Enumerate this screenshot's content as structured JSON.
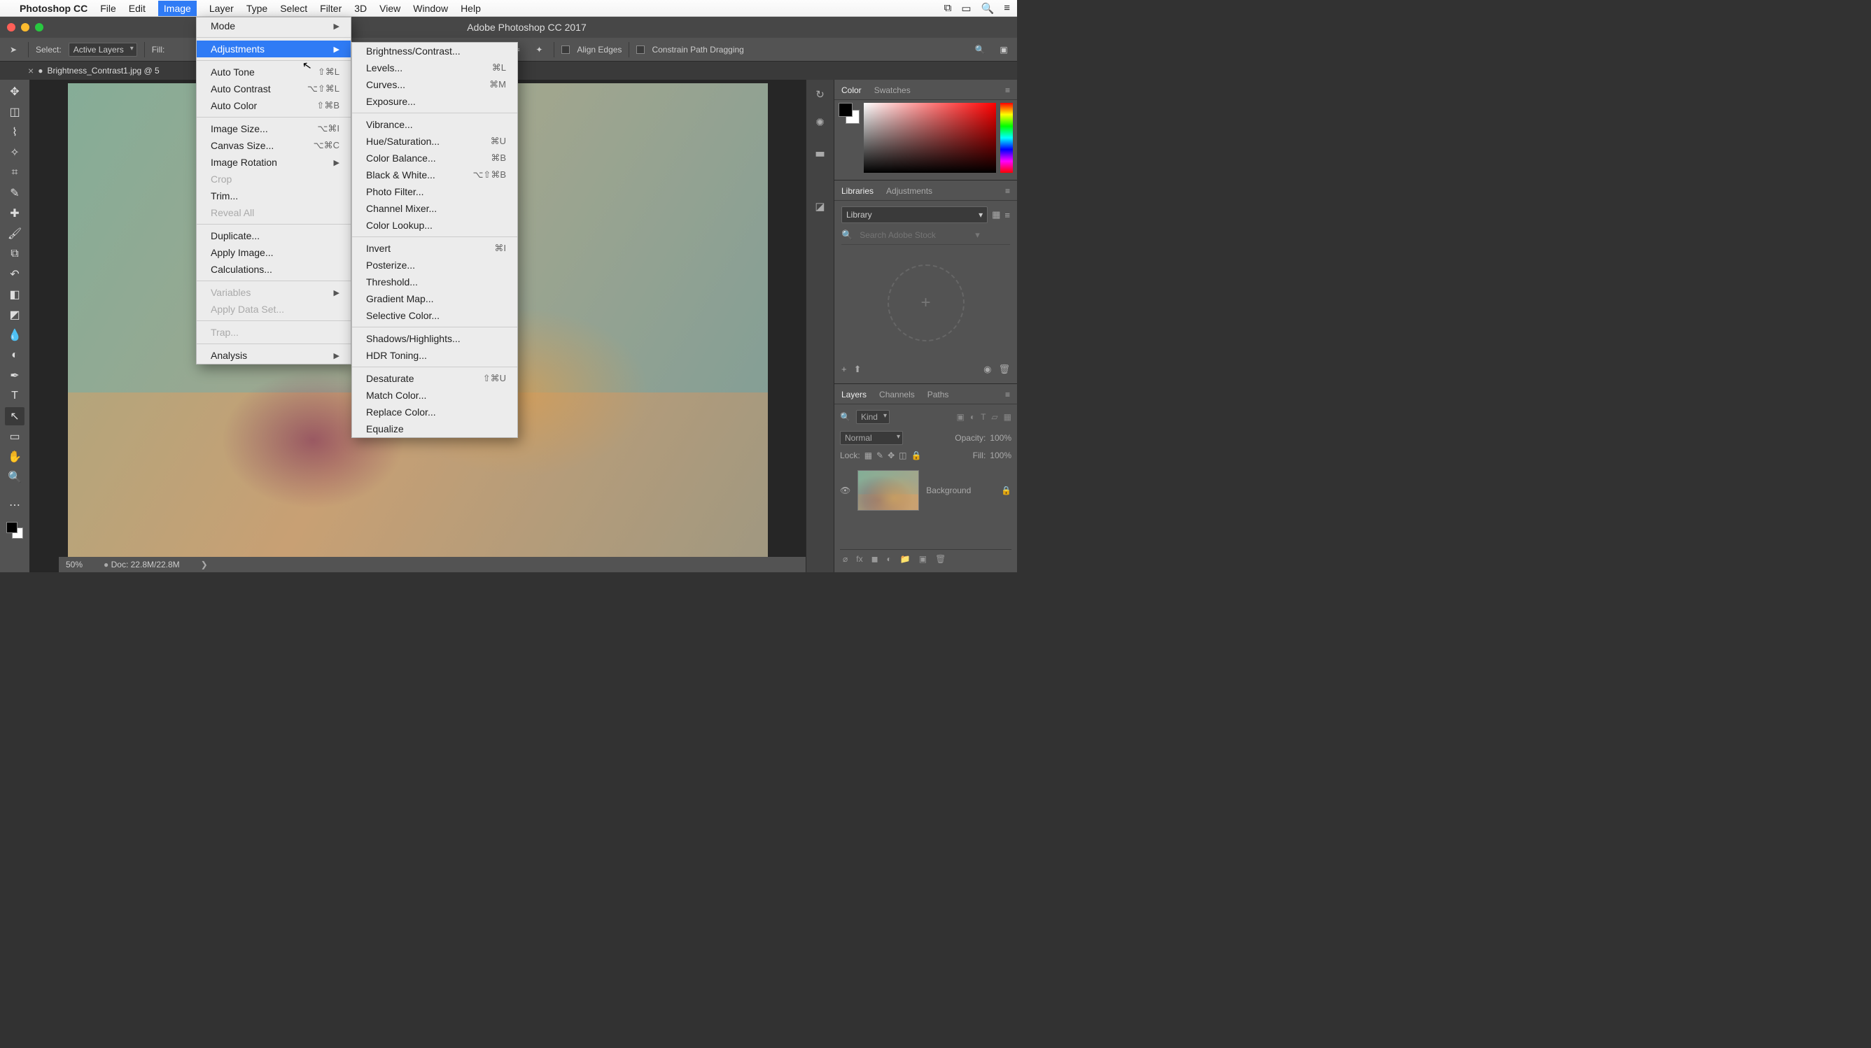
{
  "mac_menu": {
    "app_name": "Photoshop CC",
    "items": [
      "File",
      "Edit",
      "Image",
      "Layer",
      "Type",
      "Select",
      "Filter",
      "3D",
      "View",
      "Window",
      "Help"
    ],
    "active_index": 2
  },
  "app_title": "Adobe Photoshop CC 2017",
  "options_bar": {
    "select_label": "Select:",
    "select_value": "Active Layers",
    "fill_label": "Fill:",
    "align_edges": "Align Edges",
    "constrain": "Constrain Path Dragging"
  },
  "doc_tab": {
    "name": "Brightness_Contrast1.jpg @ 5"
  },
  "status_bar": {
    "zoom": "50%",
    "doc": "Doc: 22.8M/22.8M"
  },
  "menu_image": {
    "groups": [
      [
        {
          "label": "Mode",
          "arrow": true
        }
      ],
      [
        {
          "label": "Adjustments",
          "arrow": true,
          "hover": true
        }
      ],
      [
        {
          "label": "Auto Tone",
          "shortcut": "⇧⌘L"
        },
        {
          "label": "Auto Contrast",
          "shortcut": "⌥⇧⌘L"
        },
        {
          "label": "Auto Color",
          "shortcut": "⇧⌘B"
        }
      ],
      [
        {
          "label": "Image Size...",
          "shortcut": "⌥⌘I"
        },
        {
          "label": "Canvas Size...",
          "shortcut": "⌥⌘C"
        },
        {
          "label": "Image Rotation",
          "arrow": true
        },
        {
          "label": "Crop",
          "disabled": true
        },
        {
          "label": "Trim..."
        },
        {
          "label": "Reveal All",
          "disabled": true
        }
      ],
      [
        {
          "label": "Duplicate..."
        },
        {
          "label": "Apply Image..."
        },
        {
          "label": "Calculations..."
        }
      ],
      [
        {
          "label": "Variables",
          "arrow": true,
          "disabled": true
        },
        {
          "label": "Apply Data Set...",
          "disabled": true
        }
      ],
      [
        {
          "label": "Trap...",
          "disabled": true
        }
      ],
      [
        {
          "label": "Analysis",
          "arrow": true
        }
      ]
    ]
  },
  "menu_adjustments": {
    "groups": [
      [
        {
          "label": "Brightness/Contrast..."
        },
        {
          "label": "Levels...",
          "shortcut": "⌘L"
        },
        {
          "label": "Curves...",
          "shortcut": "⌘M"
        },
        {
          "label": "Exposure..."
        }
      ],
      [
        {
          "label": "Vibrance..."
        },
        {
          "label": "Hue/Saturation...",
          "shortcut": "⌘U"
        },
        {
          "label": "Color Balance...",
          "shortcut": "⌘B"
        },
        {
          "label": "Black & White...",
          "shortcut": "⌥⇧⌘B"
        },
        {
          "label": "Photo Filter..."
        },
        {
          "label": "Channel Mixer..."
        },
        {
          "label": "Color Lookup..."
        }
      ],
      [
        {
          "label": "Invert",
          "shortcut": "⌘I"
        },
        {
          "label": "Posterize..."
        },
        {
          "label": "Threshold..."
        },
        {
          "label": "Gradient Map..."
        },
        {
          "label": "Selective Color..."
        }
      ],
      [
        {
          "label": "Shadows/Highlights..."
        },
        {
          "label": "HDR Toning..."
        }
      ],
      [
        {
          "label": "Desaturate",
          "shortcut": "⇧⌘U"
        },
        {
          "label": "Match Color..."
        },
        {
          "label": "Replace Color..."
        },
        {
          "label": "Equalize"
        }
      ]
    ]
  },
  "panels": {
    "color_tabs": [
      "Color",
      "Swatches"
    ],
    "lib_tabs": [
      "Libraries",
      "Adjustments"
    ],
    "lib_select": "Library",
    "lib_search_placeholder": "Search Adobe Stock",
    "layers_tabs": [
      "Layers",
      "Channels",
      "Paths"
    ],
    "layers_kind": "Kind",
    "layers_blend": "Normal",
    "opacity_label": "Opacity:",
    "opacity_value": "100%",
    "lock_label": "Lock:",
    "fill_label": "Fill:",
    "fill_value": "100%",
    "layer_name": "Background"
  },
  "tools": [
    "move",
    "marquee",
    "lasso",
    "wand",
    "crop",
    "eyedropper",
    "heal",
    "brush",
    "stamp",
    "history",
    "eraser",
    "gradient",
    "blur",
    "dodge",
    "pen",
    "type",
    "path",
    "rect",
    "hand",
    "zoom"
  ]
}
